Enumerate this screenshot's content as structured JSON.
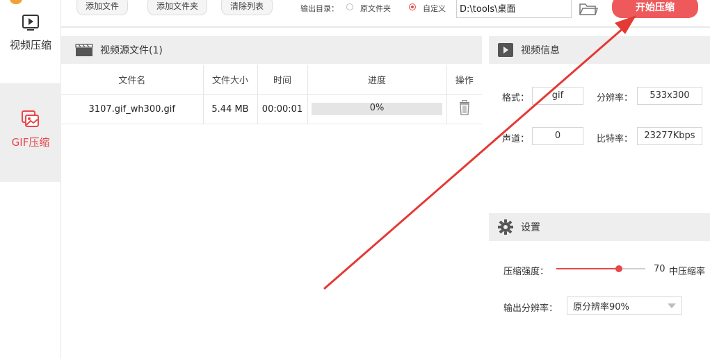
{
  "sidebar": {
    "items": [
      {
        "label": "视频压缩",
        "icon": "video-play-icon"
      },
      {
        "label": "GIF压缩",
        "icon": "gif-image-icon"
      }
    ]
  },
  "toolbar": {
    "add_file": "添加文件",
    "add_folder": "添加文件夹",
    "clear_list": "清除列表",
    "output_dir_label": "输出目录：",
    "radio_source": "原文件夹",
    "radio_custom": "自定义",
    "path_value": "D:\\tools\\桌面",
    "start_button": "开始压缩"
  },
  "file_panel": {
    "title": "视频源文件(1)",
    "columns": [
      "文件名",
      "文件大小",
      "时间",
      "进度",
      "操作"
    ],
    "rows": [
      {
        "name": "3107.gif_wh300.gif",
        "size": "5.44 MB",
        "time": "00:00:01",
        "progress": "0%",
        "progress_value": 0
      }
    ]
  },
  "video_info": {
    "title": "视频信息",
    "format_label": "格式：",
    "format_value": "gif",
    "resolution_label": "分辨率：",
    "resolution_value": "533x300",
    "channel_label": "声道：",
    "channel_value": "0",
    "bitrate_label": "比特率：",
    "bitrate_value": "23277Kbps"
  },
  "settings": {
    "title": "设置",
    "strength_label": "压缩强度：",
    "strength_value": "70",
    "strength_percent": 0.7,
    "strength_text": "中压缩率",
    "output_res_label": "输出分辨率：",
    "output_res_value": "原分辨率90%"
  },
  "colors": {
    "accent": "#e8474a",
    "start_button": "#ee5a5c",
    "annotation_arrow": "#e53935"
  }
}
